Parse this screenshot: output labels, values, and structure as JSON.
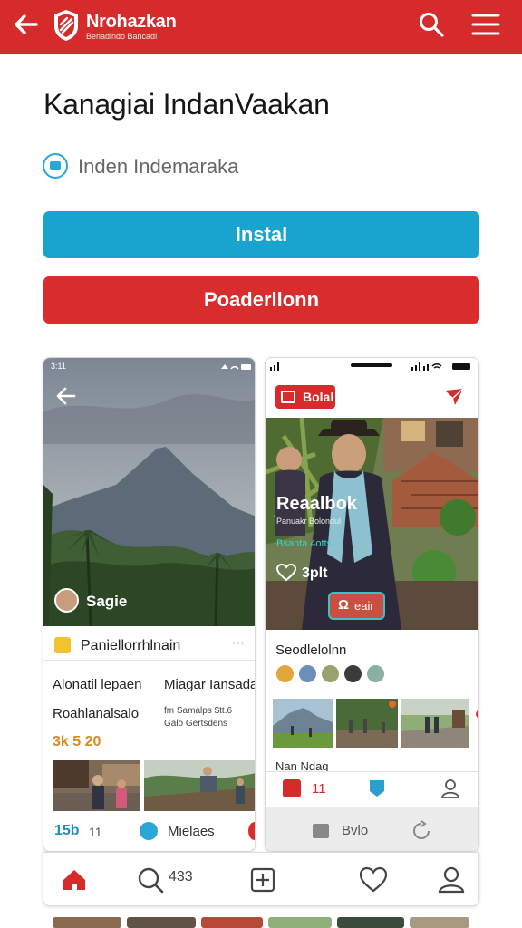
{
  "header": {
    "brand": "Nrohazkan",
    "brand_sub": "Benadindo Bancadi",
    "back_icon": "arrow-left-icon",
    "logo_icon": "brand-logo-icon",
    "search_icon": "search-icon",
    "menu_icon": "hamburger-menu-icon",
    "color": "#d62b2b"
  },
  "app": {
    "title": "Kanagiai IndanVaakan",
    "developer": "Inden Indemaraka",
    "install_label": "Instal",
    "secondary_label": "Poaderllonn",
    "install_color": "#19a3cf",
    "secondary_color": "#d92d2d"
  },
  "shot_left": {
    "status_time": "3:11",
    "profile_name": "Sagie",
    "card_title": "Paniellorrhlnain",
    "col1_line1": "Alonatil lepaen",
    "col2_line1": "Miagar Iansada",
    "col1_line2": "Roahlanalsalo",
    "col2_line2a": "fm  Samalps  $tt.6",
    "col2_line2b": "Galo  Gertsdens",
    "price": "3k 5 20",
    "footer_count": "15b",
    "footer_count2": "11",
    "footer_label": "Mielaes"
  },
  "shot_right": {
    "tag_label": "Bolal",
    "overlay_title": "Reaalbok",
    "overlay_sub": "Panuakr Bolondul",
    "overlay_sub2": "Bsanta 4otts",
    "likes": "3plt",
    "cta_label": "eair",
    "section_title": "Seodlelolnn",
    "caption": "Nan Ndag",
    "nav_count": "11",
    "footer_label": "Bvlo"
  },
  "bottom_nav": {
    "count": "433",
    "items": [
      "home-icon",
      "search-icon",
      "add-icon",
      "heart-icon",
      "profile-icon"
    ]
  }
}
